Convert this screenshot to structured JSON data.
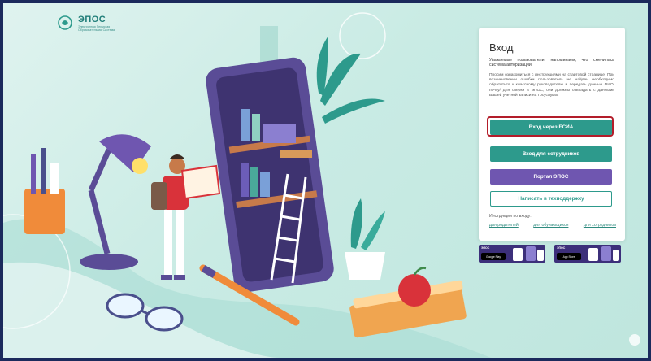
{
  "logo": {
    "name": "ЭПОС",
    "subtitle": "Электронная Пермская Образовательная Система"
  },
  "login": {
    "title": "Вход",
    "notice": "Уважаемые пользователи, напоминаем, что сменилась система авторизации.",
    "info": "Просим ознакомиться с инструкциями на стартовой странице. При возникновении ошибки пользователь не найден необходимо обратиться к классному руководителю и передать данные ФИО/ почту/ для сверки в ЭПОС, они должны совпадать с данными Вашей учетной записи на Госуслугах.",
    "btn_esia": "Вход через ЕСИА",
    "btn_staff": "Вход для сотрудников",
    "btn_portal": "Портал ЭПОС",
    "btn_support": "Написать в техподдержку",
    "instructions_label": "Инструкции по входу:",
    "links": [
      "для родителей",
      "для обучающихся",
      "для сотрудников"
    ]
  },
  "stores": {
    "android": {
      "top": "ЭПОС",
      "badge": "Google Play"
    },
    "ios": {
      "top": "ЭПОС",
      "badge": "App Store"
    }
  },
  "colors": {
    "teal": "#2d9a8c",
    "purple": "#6f56b0",
    "highlight": "#b31d2a"
  }
}
